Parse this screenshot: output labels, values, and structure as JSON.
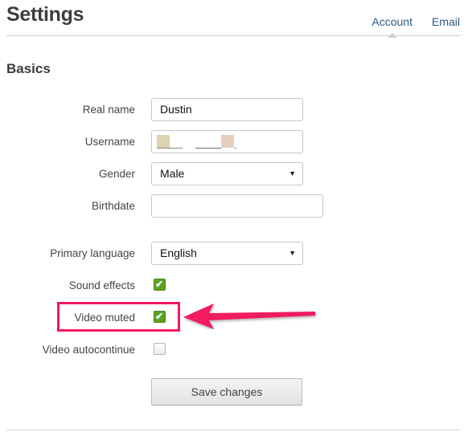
{
  "header": {
    "title": "Settings",
    "tabs": [
      {
        "label": "Account",
        "active": true
      },
      {
        "label": "Email",
        "active": false
      }
    ]
  },
  "section": {
    "title": "Basics"
  },
  "form": {
    "real_name": {
      "label": "Real name",
      "value": "Dustin"
    },
    "username": {
      "label": "Username",
      "value": ""
    },
    "gender": {
      "label": "Gender",
      "value": "Male",
      "caret": "▼"
    },
    "birthdate": {
      "label": "Birthdate",
      "value": ""
    },
    "primary_language": {
      "label": "Primary language",
      "value": "English",
      "caret": "▼"
    },
    "sound_effects": {
      "label": "Sound effects",
      "checked": true,
      "tick": "✔"
    },
    "video_muted": {
      "label": "Video muted",
      "checked": true,
      "tick": "✔"
    },
    "video_autocontinue": {
      "label": "Video autocontinue",
      "checked": false
    },
    "save_label": "Save changes"
  },
  "annotation": {
    "color": "#f01a5e",
    "target": "Video muted"
  }
}
